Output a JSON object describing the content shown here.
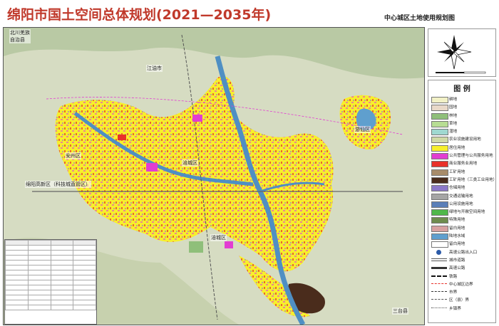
{
  "title": "绵阳市国土空间总体规划(2021—2035年)",
  "subtitle": "中心城区土地使用规划图",
  "map": {
    "places": [
      {
        "label": "北川羌族",
        "sub": "自治县"
      },
      {
        "label": "江油市"
      },
      {
        "label": "安州区"
      },
      {
        "label": "游仙区"
      },
      {
        "label": "涪城区"
      },
      {
        "label": "绵阳高新区（科技城直管区）"
      },
      {
        "label": "涪城区"
      },
      {
        "label": "三台县"
      }
    ]
  },
  "legend": {
    "title": "图  例",
    "items": [
      {
        "label": "耕地",
        "color": "#f2f1c6"
      },
      {
        "label": "园地",
        "color": "#e9d9c9"
      },
      {
        "label": "林地",
        "color": "#8fbf7a"
      },
      {
        "label": "草地",
        "color": "#b7dd93"
      },
      {
        "label": "湿地",
        "color": "#9fd8d0"
      },
      {
        "label": "农业设施建设用地",
        "color": "#cfd9a6"
      },
      {
        "label": "居住用地",
        "color": "#f7ef2c"
      },
      {
        "label": "公共管理与公共服务用地",
        "color": "#e23dd2"
      },
      {
        "label": "商业服务业用地",
        "color": "#e8312a"
      },
      {
        "label": "工矿用地",
        "color": "#a88c6a"
      },
      {
        "label": "工矿用地（三类工业用地）",
        "color": "#4a2c1c"
      },
      {
        "label": "仓储用地",
        "color": "#8c79c8"
      },
      {
        "label": "交通运输用地",
        "color": "#a5a5a5"
      },
      {
        "label": "公用设施用地",
        "color": "#5b7fb8"
      },
      {
        "label": "绿地与开敞空间用地",
        "color": "#4fb84a"
      },
      {
        "label": "特殊用地",
        "color": "#6e8c4e"
      },
      {
        "label": "留白用地",
        "color": "#d8a1a1"
      },
      {
        "label": "陆地水域",
        "color": "#5f9fce"
      },
      {
        "label": "留白用地",
        "color": "#ffffff"
      }
    ],
    "symbols": [
      {
        "label": "高速公路出入口",
        "type": "dot"
      },
      {
        "label": "城市道路",
        "type": "double"
      },
      {
        "label": "高速公路",
        "type": "thick"
      },
      {
        "label": "铁路",
        "type": "rail"
      },
      {
        "label": "中心城区边界",
        "type": "dashred"
      },
      {
        "label": "市界",
        "type": "dashdot"
      },
      {
        "label": "区（县）界",
        "type": "dashdot2"
      },
      {
        "label": "乡镇界",
        "type": "dot2"
      }
    ]
  },
  "colors": {
    "title": "#c0392b",
    "river": "#4f8fc3",
    "residential": "#f7ef2c",
    "background": "#d6dcc2"
  }
}
